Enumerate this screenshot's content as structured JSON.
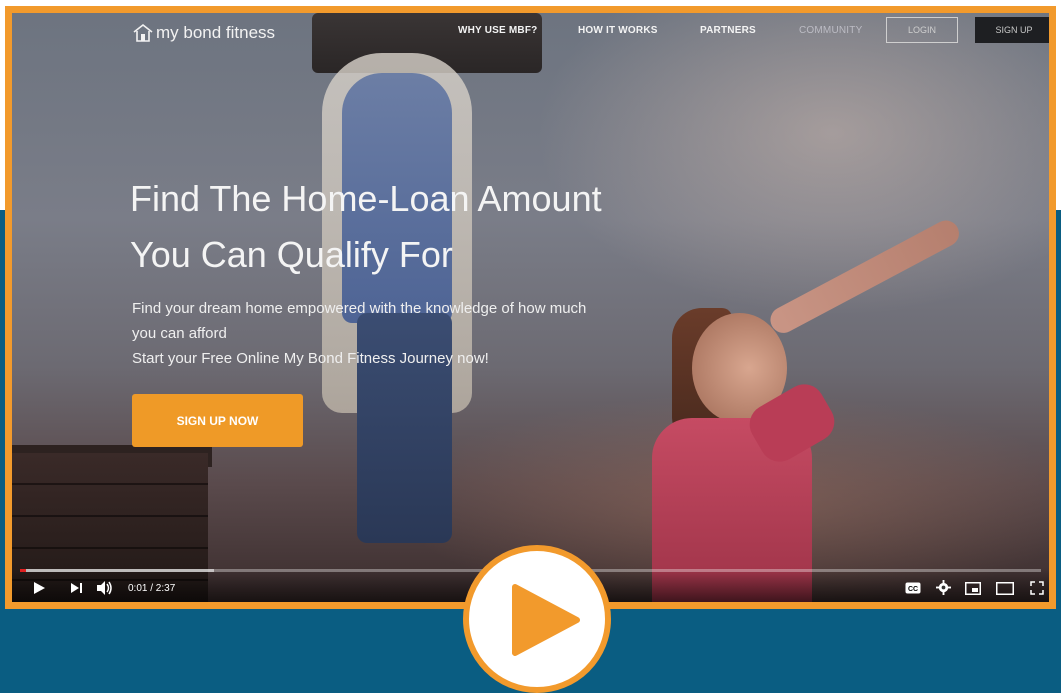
{
  "nav": {
    "logo": "my bond fitness",
    "links": [
      "WHY USE MBF?",
      "HOW IT WORKS",
      "PARTNERS",
      "COMMUNITY"
    ],
    "login": "LOGIN",
    "signup": "SIGN UP"
  },
  "hero": {
    "title_line1": "Find The Home-Loan Amount",
    "title_line2": "You Can Qualify For",
    "subtitle_line1": "Find your dream home empowered with the knowledge of how much",
    "subtitle_line2": "you can afford",
    "subtitle_line3": "Start your Free Online My Bond Fitness Journey now!",
    "cta": "SIGN UP NOW"
  },
  "player": {
    "time": "0:01 / 2:37",
    "progress_fraction": 0.006,
    "buffered_fraction": 0.19,
    "cc_label": "CC"
  },
  "colors": {
    "accent_orange": "#f29a2c",
    "background_blue": "#0a5d82",
    "progress_red": "#e02020"
  }
}
